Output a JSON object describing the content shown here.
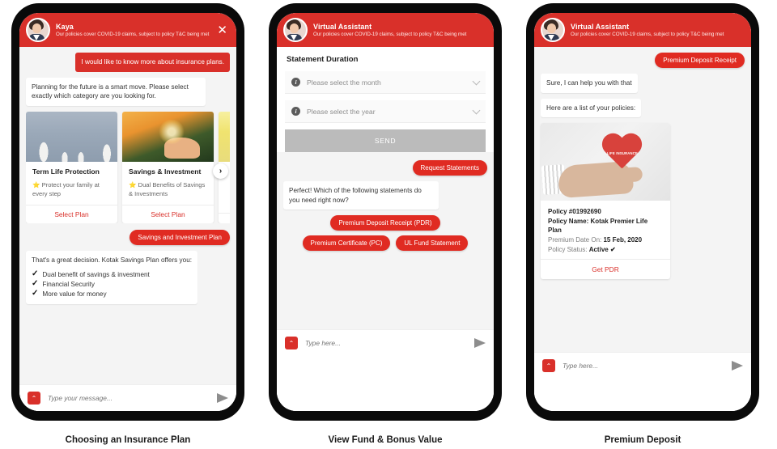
{
  "panels": [
    {
      "caption": "Choosing an Insurance Plan",
      "header": {
        "name": "Kaya",
        "subtitle": "Our policies cover COVID-19 claims, subject to policy T&C being met",
        "close_label": "✕"
      },
      "messages": {
        "user_1": "I would like to know more about insurance plans.",
        "bot_1": "Planning for the future is a smart move. Please select exactly which category are you looking for.",
        "chip_1": "Savings and Investment Plan",
        "bot_2_intro": "That's a great decision. Kotak Savings Plan offers you:",
        "bot_2_items": [
          "Dual benefit of savings & investment",
          "Financial Security",
          "More value for money"
        ]
      },
      "carousel": {
        "next_label": "›",
        "cards": [
          {
            "title": "Term Life Protection",
            "desc": "Protect your family at every step",
            "cta": "Select Plan",
            "star": "⭐"
          },
          {
            "title": "Savings & Investment",
            "desc": "Dual Benefits of Savings & Investments",
            "cta": "Select Plan",
            "star": "⭐"
          },
          {
            "title": "",
            "desc": "",
            "cta": "",
            "star": ""
          }
        ]
      },
      "composer": {
        "placeholder": "Type your message...",
        "up_icon": "⌃"
      }
    },
    {
      "caption": "View Fund & Bonus Value",
      "header": {
        "name": "Virtual Assistant",
        "subtitle": "Our policies cover COVID-19 claims, subject to policy T&C being met"
      },
      "form": {
        "title": "Statement Duration",
        "month_placeholder": "Please select the month",
        "year_placeholder": "Please select the year",
        "info_glyph": "i",
        "send_label": "SEND"
      },
      "messages": {
        "user_1": "Request Statements",
        "bot_1": "Perfect! Which of the following statements do you need right now?",
        "options": [
          "Premium Deposit Receipt (PDR)",
          "Premium Certificate (PC)",
          "UL Fund Statement"
        ]
      },
      "composer": {
        "placeholder": "Type here...",
        "up_icon": "⌃"
      }
    },
    {
      "caption": "Premium Deposit",
      "header": {
        "name": "Virtual Assistant",
        "subtitle": "Our policies cover COVID-19 claims, subject to policy T&C being met"
      },
      "messages": {
        "user_1": "Premium Deposit Receipt",
        "bot_1": "Sure, I can help you with that",
        "bot_2": "Here are a list of your policies:"
      },
      "policy": {
        "image_label": "LIFE INSURANCE",
        "number": "Policy #01992690",
        "name": "Policy Name: Kotak Premier Life Plan",
        "date_label": "Premium Date On:",
        "date_value": "15 Feb, 2020",
        "status_label": "Policy Status:",
        "status_value": "Active ✔",
        "cta": "Get PDR"
      },
      "composer": {
        "placeholder": "Type here...",
        "up_icon": "⌃"
      }
    }
  ],
  "colors": {
    "brand_red": "#D9302A",
    "chip_red": "#E02B22",
    "chat_bg": "#F4F4F4",
    "disabled_gray": "#BBBBBB"
  }
}
